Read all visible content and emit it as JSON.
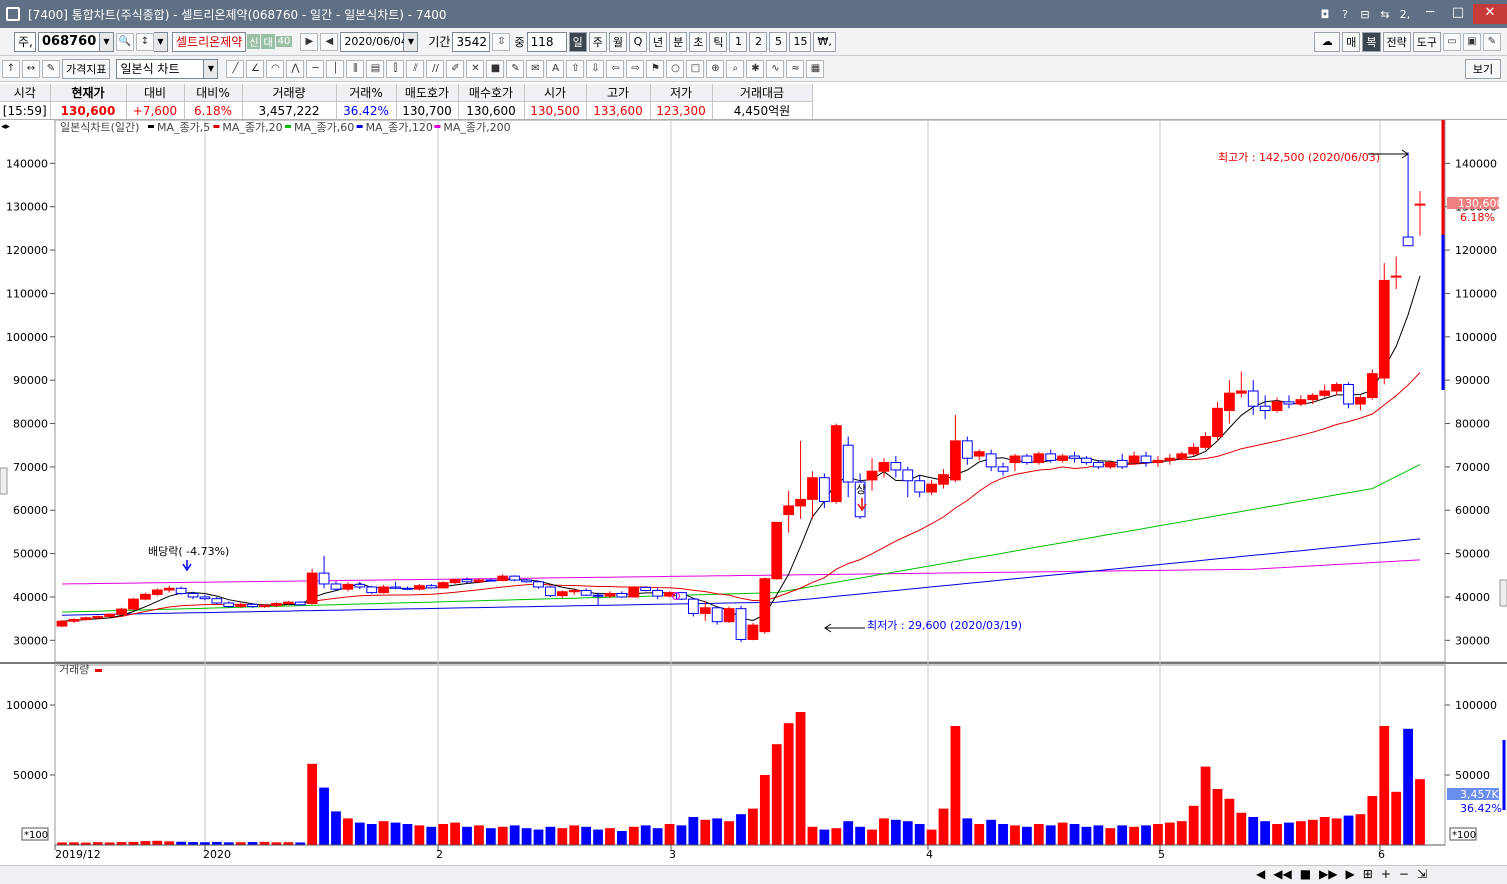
{
  "window": {
    "title": "[7400] 통합차트(주식종합) - 셀트리온제약(068760 - 일간 - 일본식차트) - 7400",
    "title_buttons": [
      "◘",
      "?",
      "⊟",
      "⇆",
      "2,"
    ],
    "minimize": "─",
    "maximize": "□",
    "close": "✕"
  },
  "toolbar1": {
    "market_type": "주,",
    "stock_code": "068760",
    "stock_name": "셀트리온제약",
    "badge1": "신",
    "badge2": "대",
    "badge3": "40",
    "date": "2020/06/04",
    "period_label": "기간",
    "period_value": "3542",
    "count_label": "중",
    "count_value": "118",
    "interval_buttons": [
      "일",
      "주",
      "월",
      "Q",
      "년",
      "분",
      "초",
      "틱",
      "1",
      "2",
      "5",
      "15",
      "₩,"
    ],
    "right_buttons": [
      "매",
      "복",
      "전략",
      "도구"
    ]
  },
  "toolbar2": {
    "indicator_button": "가격지표",
    "chart_type": "일본식 차트",
    "view_button": "보기"
  },
  "quote": {
    "headers": [
      "시각",
      "현재가",
      "대비",
      "대비%",
      "거래량",
      "거래%",
      "매도호가",
      "매수호가",
      "시가",
      "고가",
      "저가",
      "거래대금"
    ],
    "values": [
      "[15:59]",
      "130,600",
      "+7,600",
      "6.18%",
      "3,457,222",
      "36.42%",
      "130,700",
      "130,600",
      "130,500",
      "133,600",
      "123,300",
      "4,450억원"
    ]
  },
  "chart_data": {
    "type": "candlestick",
    "legend": "일본식차트(일간)",
    "ma_legend": [
      "MA_종가,5",
      "MA_종가,20",
      "MA_종가,60",
      "MA_종가,120",
      "MA_종가,200"
    ],
    "ma_colors": [
      "#000000",
      "#e00000",
      "#00c000",
      "#0000e0",
      "#e000e0"
    ],
    "price_ticks": [
      30000,
      40000,
      50000,
      60000,
      70000,
      80000,
      90000,
      100000,
      110000,
      120000,
      130000,
      140000
    ],
    "price_range": [
      25000,
      150000
    ],
    "x_labels": [
      "2019/12",
      "2020",
      "2",
      "3",
      "4",
      "5",
      "6"
    ],
    "annotations": {
      "dividend": "배당락( -4.73%)",
      "high": "최고가 : 142,500 (2020/06/03)",
      "low": "최저가 : 29,600 (2020/03/19)",
      "limit_up": "상"
    },
    "current_price_label": "130,600",
    "current_change_label": "6.18%",
    "volume_title": "거래량",
    "volume_ticks": [
      50000,
      100000
    ],
    "volume_unit": "*100",
    "current_volume_label": "3,457K",
    "current_volume_pct": "36.42%",
    "candles": [
      [
        33.3,
        34.7,
        33.0,
        34.4
      ],
      [
        34.4,
        35.1,
        34.0,
        34.8
      ],
      [
        34.8,
        35.4,
        34.5,
        35.2
      ],
      [
        35.2,
        35.7,
        34.8,
        35.5
      ],
      [
        35.5,
        36.2,
        35.3,
        36.0
      ],
      [
        36.0,
        37.5,
        35.8,
        37.2
      ],
      [
        37.2,
        39.8,
        37.0,
        39.5
      ],
      [
        39.5,
        41.0,
        39.2,
        40.6
      ],
      [
        40.6,
        42.0,
        40.2,
        41.6
      ],
      [
        41.6,
        42.6,
        41.0,
        42.0
      ],
      [
        42.0,
        42.4,
        40.5,
        40.8
      ],
      [
        40.8,
        41.2,
        39.5,
        40.0
      ],
      [
        40.0,
        40.5,
        39.2,
        39.6
      ],
      [
        39.6,
        40.0,
        38.3,
        38.6
      ],
      [
        38.6,
        39.0,
        37.5,
        37.8
      ],
      [
        37.8,
        38.6,
        37.5,
        38.3
      ],
      [
        38.3,
        38.5,
        37.5,
        37.8
      ],
      [
        37.8,
        38.2,
        37.5,
        38.0
      ],
      [
        38.0,
        38.8,
        37.7,
        38.5
      ],
      [
        38.5,
        39.1,
        38.2,
        38.8
      ],
      [
        38.8,
        39.0,
        38.0,
        38.2
      ],
      [
        38.5,
        46.5,
        38.3,
        45.5
      ],
      [
        45.5,
        49.5,
        42.0,
        43.0
      ],
      [
        43.0,
        43.6,
        41.5,
        41.8
      ],
      [
        41.8,
        43.4,
        41.3,
        42.9
      ],
      [
        42.9,
        43.5,
        41.8,
        42.3
      ],
      [
        42.3,
        42.6,
        40.7,
        41.0
      ],
      [
        41.0,
        42.8,
        40.8,
        42.3
      ],
      [
        42.3,
        43.5,
        41.8,
        42.0
      ],
      [
        42.0,
        42.4,
        41.6,
        41.8
      ],
      [
        41.8,
        43.0,
        41.5,
        42.6
      ],
      [
        42.6,
        43.0,
        41.9,
        42.1
      ],
      [
        42.1,
        43.6,
        41.9,
        43.3
      ],
      [
        43.3,
        44.2,
        43.0,
        44.0
      ],
      [
        44.0,
        44.5,
        43.2,
        43.5
      ],
      [
        43.5,
        44.3,
        43.2,
        43.9
      ],
      [
        43.9,
        44.2,
        43.6,
        43.8
      ],
      [
        43.8,
        45.2,
        43.6,
        44.8
      ],
      [
        44.8,
        45.0,
        43.6,
        43.9
      ],
      [
        43.9,
        44.1,
        43.3,
        43.5
      ],
      [
        43.5,
        43.8,
        41.9,
        42.3
      ],
      [
        42.3,
        42.5,
        40.0,
        40.3
      ],
      [
        40.3,
        41.5,
        39.8,
        41.2
      ],
      [
        41.2,
        42.0,
        40.5,
        41.5
      ],
      [
        41.5,
        42.0,
        40.2,
        40.4
      ],
      [
        40.4,
        41.0,
        38.0,
        40.2
      ],
      [
        40.2,
        41.3,
        39.8,
        40.8
      ],
      [
        40.8,
        41.3,
        39.8,
        40.0
      ],
      [
        40.0,
        42.5,
        39.9,
        42.2
      ],
      [
        42.2,
        42.4,
        41.3,
        41.5
      ],
      [
        41.5,
        42.0,
        39.5,
        40.2
      ],
      [
        40.2,
        41.3,
        39.9,
        41.0
      ],
      [
        41.0,
        41.2,
        39.3,
        39.5
      ],
      [
        39.5,
        39.8,
        35.5,
        36.2
      ],
      [
        36.2,
        39.0,
        34.5,
        37.5
      ],
      [
        37.5,
        37.6,
        33.6,
        34.3
      ],
      [
        34.3,
        37.8,
        34.0,
        37.3
      ],
      [
        37.3,
        38.0,
        29.6,
        30.2
      ],
      [
        30.2,
        34.0,
        30.0,
        33.5
      ],
      [
        32.0,
        44.5,
        31.5,
        44.2
      ],
      [
        44.2,
        57.2,
        44.0,
        57.2
      ],
      [
        59.0,
        64.5,
        54.8,
        61.0
      ],
      [
        61.0,
        76.0,
        58.0,
        62.5
      ],
      [
        62.5,
        69.0,
        58.0,
        67.5
      ],
      [
        67.5,
        68.5,
        60.5,
        62.0
      ],
      [
        62.0,
        80.0,
        61.5,
        79.5
      ],
      [
        75.0,
        77.0,
        63.0,
        66.5
      ],
      [
        66.5,
        68.5,
        58.0,
        58.5
      ],
      [
        67.0,
        72.0,
        64.5,
        69.0
      ],
      [
        69.0,
        72.0,
        67.5,
        71.0
      ],
      [
        71.0,
        72.5,
        67.5,
        69.3
      ],
      [
        69.3,
        70.0,
        63.0,
        66.8
      ],
      [
        66.8,
        68.0,
        63.0,
        64.2
      ],
      [
        64.2,
        67.0,
        63.5,
        66.0
      ],
      [
        66.0,
        69.5,
        65.0,
        68.2
      ],
      [
        67.0,
        82.0,
        66.5,
        76.0
      ],
      [
        76.0,
        77.0,
        70.5,
        72.0
      ],
      [
        72.5,
        74.0,
        71.5,
        73.5
      ],
      [
        73.0,
        74.0,
        69.0,
        70.0
      ],
      [
        70.0,
        71.0,
        68.0,
        69.0
      ],
      [
        71.0,
        73.0,
        69.0,
        72.5
      ],
      [
        72.5,
        73.0,
        70.5,
        71.0
      ],
      [
        71.0,
        73.5,
        70.5,
        73.0
      ],
      [
        73.0,
        74.0,
        71.0,
        71.5
      ],
      [
        71.5,
        73.0,
        71.0,
        72.5
      ],
      [
        72.5,
        73.5,
        71.0,
        72.0
      ],
      [
        72.0,
        72.5,
        70.5,
        71.0
      ],
      [
        71.0,
        71.5,
        69.5,
        70.0
      ],
      [
        70.0,
        71.5,
        69.5,
        71.0
      ],
      [
        71.5,
        73.0,
        69.5,
        70.0
      ],
      [
        71.0,
        73.5,
        70.5,
        72.5
      ],
      [
        72.5,
        73.5,
        70.0,
        71.0
      ],
      [
        71.0,
        72.5,
        70.0,
        71.5
      ],
      [
        71.5,
        73.0,
        70.5,
        72.0
      ],
      [
        72.0,
        73.5,
        71.5,
        73.0
      ],
      [
        73.0,
        75.5,
        72.5,
        74.5
      ],
      [
        74.5,
        78.0,
        74.0,
        77.0
      ],
      [
        77.0,
        85.0,
        76.0,
        83.5
      ],
      [
        83.0,
        90.0,
        80.0,
        87.0
      ],
      [
        87.0,
        92.0,
        86.0,
        87.5
      ],
      [
        87.5,
        90.0,
        82.0,
        84.0
      ],
      [
        84.0,
        86.5,
        81.0,
        83.0
      ],
      [
        83.0,
        86.0,
        82.5,
        85.0
      ],
      [
        85.0,
        86.5,
        83.5,
        84.5
      ],
      [
        84.5,
        86.5,
        84.0,
        85.5
      ],
      [
        85.5,
        87.0,
        84.5,
        86.5
      ],
      [
        86.5,
        89.0,
        86.0,
        87.5
      ],
      [
        87.5,
        89.5,
        86.5,
        89.0
      ],
      [
        89.0,
        89.5,
        83.5,
        84.5
      ],
      [
        84.5,
        86.5,
        83.0,
        86.0
      ],
      [
        86.0,
        92.5,
        85.5,
        91.5
      ],
      [
        90.5,
        117.0,
        89.0,
        113.0
      ],
      [
        114.0,
        118.5,
        111.0,
        114.0
      ],
      [
        123.0,
        142.5,
        121.0,
        121.0
      ],
      [
        130.5,
        133.6,
        123.3,
        130.6
      ]
    ],
    "volumes": [
      18,
      19,
      17,
      20,
      18,
      21,
      22,
      28,
      30,
      26,
      23,
      21,
      20,
      22,
      19,
      20,
      21,
      22,
      19,
      20,
      18,
      580,
      410,
      240,
      190,
      160,
      150,
      170,
      160,
      150,
      140,
      130,
      150,
      160,
      130,
      140,
      120,
      130,
      140,
      120,
      110,
      130,
      120,
      140,
      130,
      110,
      120,
      100,
      130,
      140,
      120,
      150,
      140,
      200,
      180,
      190,
      170,
      220,
      260,
      500,
      720,
      870,
      950,
      130,
      110,
      120,
      170,
      130,
      110,
      190,
      180,
      170,
      150,
      110,
      260,
      850,
      190,
      150,
      180,
      150,
      140,
      130,
      150,
      140,
      160,
      150,
      130,
      140,
      120,
      140,
      130,
      140,
      150,
      160,
      170,
      280,
      560,
      400,
      330,
      230,
      200,
      170,
      150,
      160,
      170,
      180,
      200,
      190,
      210,
      220,
      350,
      850,
      380,
      830,
      470
    ]
  }
}
